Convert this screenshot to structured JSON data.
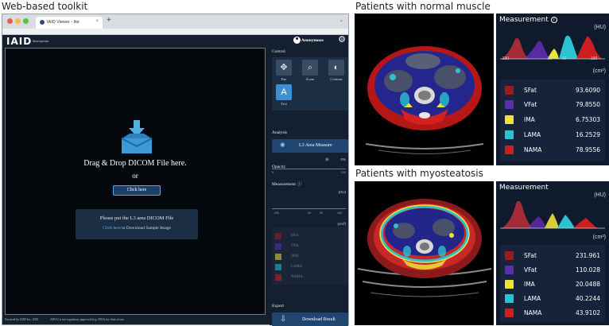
{
  "captions": {
    "left": "Web-based toolkit",
    "top_right": "Patients with normal muscle",
    "bottom_right": "Patients with myosteatosis"
  },
  "browser": {
    "tab_title": "IAID Viewer - lite",
    "tab_close": "×",
    "new_tab": "+",
    "window_menu": "⌄"
  },
  "app": {
    "logo": "IAID",
    "product": "Sarcopenia",
    "user": "Anonymous"
  },
  "viewer": {
    "drop_title": "Drag & Drop DICOM File here.",
    "or": "or",
    "click_here": "Click here",
    "info_line1": "Please put the L3 area DICOM File",
    "info_link": "Click here",
    "info_rest": " to Download Sample Image"
  },
  "footer": {
    "copyright": "Powered by IAID Inc. 2019",
    "disclaimer": "AID-U is not regulatory approved (e.g. FDA) for clinical use"
  },
  "panel": {
    "control": "Control",
    "tools": [
      {
        "label": "Pan",
        "icon": "pan-icon",
        "glyph": "✥",
        "active": false
      },
      {
        "label": "Zoom",
        "icon": "zoom-icon",
        "glyph": "⌕",
        "active": false
      },
      {
        "label": "Contrast",
        "icon": "contrast-icon",
        "glyph": "◐",
        "active": false
      },
      {
        "label": "Text",
        "icon": "text-icon",
        "glyph": "A",
        "active": true
      }
    ],
    "analysis": "Analysis",
    "l3_button": "L3 Area Measure",
    "opacity": "Opacity",
    "opacity_value": "0%",
    "slider_min": "0",
    "slider_max": "100",
    "measurement": "Measurement",
    "hu": "(HU)",
    "ticks": [
      "-190",
      "-30",
      "30",
      "150"
    ],
    "cm2": "(cm²)",
    "tissues": [
      "SFat",
      "VFat",
      "IMA",
      "LAMA",
      "NAMA"
    ],
    "export": "Export",
    "download": "Download Result"
  },
  "colors": {
    "SFat": "#9e1b1b",
    "VFat": "#5b2fb0",
    "IMA": "#ece23a",
    "LAMA": "#2cc2cf",
    "NAMA": "#cc1f1f"
  },
  "measurement_normal": {
    "title": "Measurement",
    "hu": "(HU)",
    "cm2": "(cm²)",
    "ticks": [
      "-190",
      "-30",
      "30",
      "150"
    ],
    "rows": [
      {
        "name": "SFat",
        "value": "93.6090"
      },
      {
        "name": "VFat",
        "value": "79.8550"
      },
      {
        "name": "IMA",
        "value": "6.75303"
      },
      {
        "name": "LAMA",
        "value": "16.2529"
      },
      {
        "name": "NAMA",
        "value": "78.9556"
      }
    ]
  },
  "measurement_myo": {
    "title": "Measurement",
    "hu": "(HU)",
    "cm2": "(cm²)",
    "rows": [
      {
        "name": "SFat",
        "value": "231.961"
      },
      {
        "name": "VFat",
        "value": "110.028"
      },
      {
        "name": "IMA",
        "value": "20.0488"
      },
      {
        "name": "LAMA",
        "value": "40.2244"
      },
      {
        "name": "NAMA",
        "value": "43.9102"
      }
    ]
  }
}
